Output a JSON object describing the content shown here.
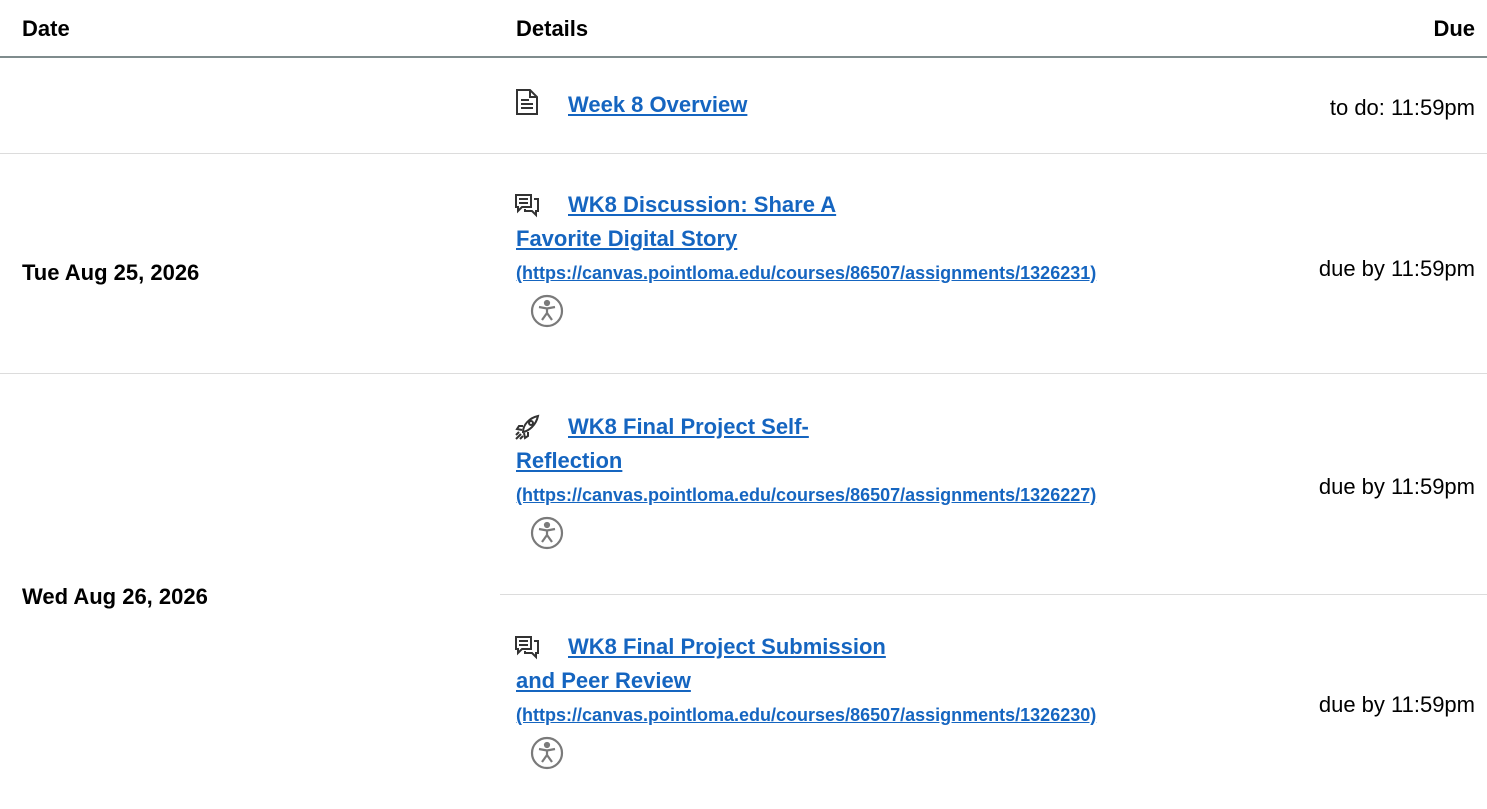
{
  "table": {
    "headers": {
      "date": "Date",
      "details": "Details",
      "due": "Due"
    }
  },
  "rows": [
    {
      "date": "",
      "items": [
        {
          "icon": "page-icon",
          "title": "Week 8 Overview",
          "due": "to do: 11:59pm"
        }
      ]
    },
    {
      "date": "Tue Aug 25, 2026",
      "items": [
        {
          "icon": "discussion-icon",
          "title_line1": "WK8 Discussion: Share A",
          "title_line2": "Favorite Digital Story",
          "url": "(https://canvas.pointloma.edu/courses/86507/assignments/1326231)",
          "due": "due by 11:59pm",
          "a11y_icon": "accessibility-icon"
        }
      ]
    },
    {
      "date": "Wed Aug 26, 2026",
      "items": [
        {
          "icon": "rocket-icon",
          "title_line1": "WK8 Final Project Self-",
          "title_line2": "Reflection",
          "url": "(https://canvas.pointloma.edu/courses/86507/assignments/1326227)",
          "due": "due by 11:59pm",
          "a11y_icon": "accessibility-icon"
        },
        {
          "icon": "discussion-icon",
          "title_line1": "WK8 Final Project Submission",
          "title_line2": "and Peer Review",
          "url": "(https://canvas.pointloma.edu/courses/86507/assignments/1326230)",
          "due": "due by 11:59pm",
          "a11y_icon": "accessibility-icon"
        }
      ]
    }
  ],
  "colors": {
    "link": "#1565c0",
    "divider": "#dcdcdc",
    "header_rule": "#7f8c8d",
    "icon": "#555555"
  }
}
